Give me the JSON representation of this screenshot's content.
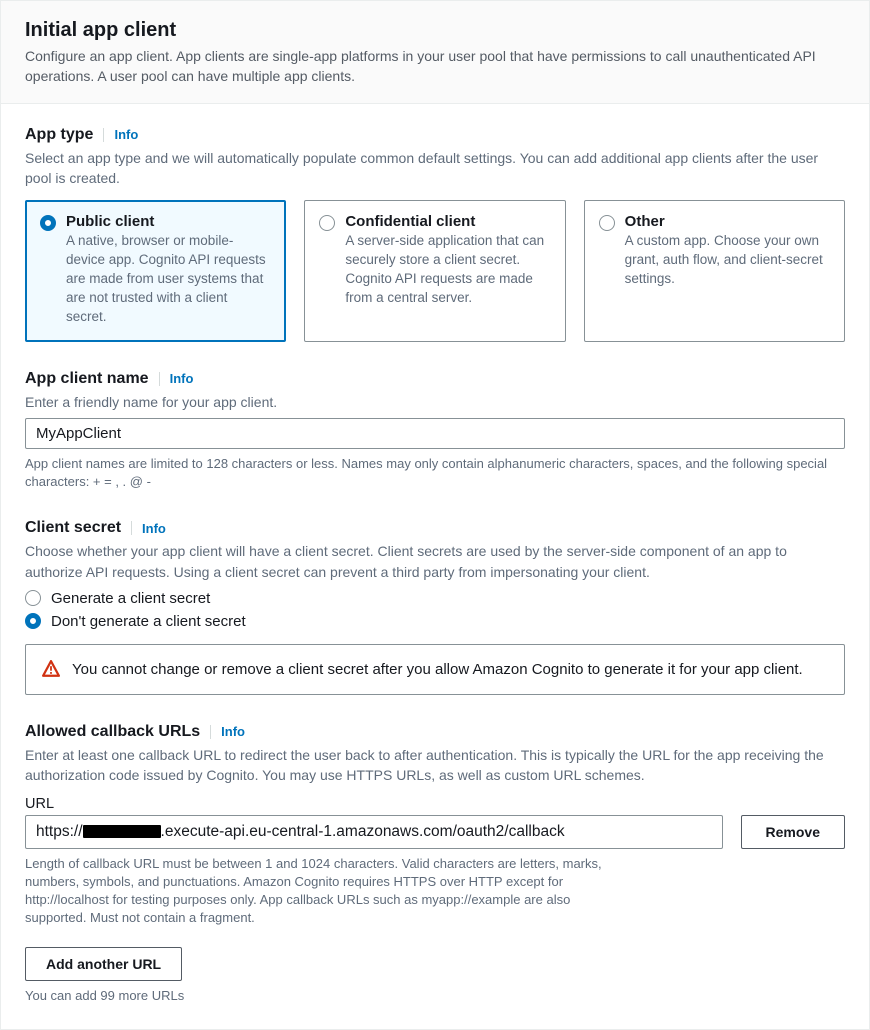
{
  "header": {
    "title": "Initial app client",
    "subtitle": "Configure an app client. App clients are single-app platforms in your user pool that have permissions to call unauthenticated API operations. A user pool can have multiple app clients."
  },
  "info_label": "Info",
  "app_type": {
    "title": "App type",
    "subtext": "Select an app type and we will automatically populate common default settings. You can add additional app clients after the user pool is created.",
    "options": [
      {
        "title": "Public client",
        "desc": "A native, browser or mobile-device app. Cognito API requests are made from user systems that are not trusted with a client secret."
      },
      {
        "title": "Confidential client",
        "desc": "A server-side application that can securely store a client secret. Cognito API requests are made from a central server."
      },
      {
        "title": "Other",
        "desc": "A custom app. Choose your own grant, auth flow, and client-secret settings."
      }
    ],
    "selected": 0
  },
  "client_name": {
    "title": "App client name",
    "subtext": "Enter a friendly name for your app client.",
    "value": "MyAppClient",
    "help": "App client names are limited to 128 characters or less. Names may only contain alphanumeric characters, spaces, and the following special characters: + = , . @ -"
  },
  "client_secret": {
    "title": "Client secret",
    "subtext": "Choose whether your app client will have a client secret. Client secrets are used by the server-side component of an app to authorize API requests. Using a client secret can prevent a third party from impersonating your client.",
    "options": [
      "Generate a client secret",
      "Don't generate a client secret"
    ],
    "selected": 1,
    "warning": "You cannot change or remove a client secret after you allow Amazon Cognito to generate it for your app client."
  },
  "callback": {
    "title": "Allowed callback URLs",
    "subtext": "Enter at least one callback URL to redirect the user back to after authentication. This is typically the URL for the app receiving the authorization code issued by Cognito. You may use HTTPS URLs, as well as custom URL schemes.",
    "field_label": "URL",
    "url_prefix": "https://",
    "url_suffix": ".execute-api.eu-central-1.amazonaws.com/oauth2/callback",
    "remove_label": "Remove",
    "help": "Length of callback URL must be between 1 and 1024 characters. Valid characters are letters, marks, numbers, symbols, and punctuations. Amazon Cognito requires HTTPS over HTTP except for http://localhost for testing purposes only. App callback URLs such as myapp://example are also supported. Must not contain a fragment.",
    "add_label": "Add another URL",
    "footer": "You can add 99 more URLs"
  }
}
